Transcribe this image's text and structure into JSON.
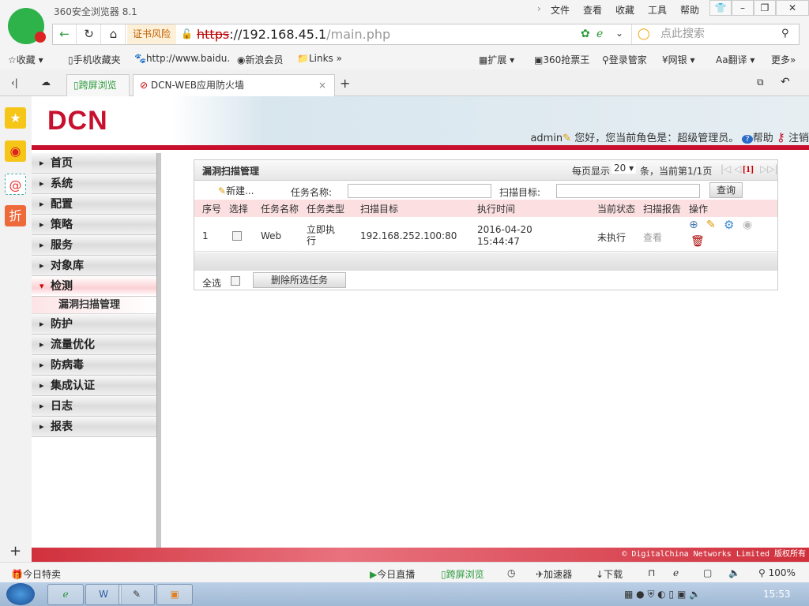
{
  "browser": {
    "title": "360安全浏览器 8.1",
    "menu": [
      "文件",
      "查看",
      "收藏",
      "工具",
      "帮助"
    ],
    "cert": "证书风险",
    "url_scheme": "https",
    "url_host": "://192.168.45.1",
    "url_path": "/main.php",
    "search_placeholder": "点此搜索",
    "bookmarks_left": [
      "收藏",
      "手机收藏夹",
      "http://www.baidu.",
      "新浪会员",
      "Links"
    ],
    "bookmarks_right": [
      "扩展",
      "360抢票王",
      "登录管家",
      "网银",
      "翻译",
      "更多"
    ],
    "tabs": [
      {
        "label": "跨屏浏览"
      },
      {
        "label": "DCN-WEB应用防火墙"
      }
    ]
  },
  "header": {
    "brand": "DCN",
    "user": "admin",
    "greeting": "您好，您当前角色是：超级管理员。",
    "help": "帮助",
    "logout": "注销"
  },
  "nav": {
    "items": [
      "首页",
      "系统",
      "配置",
      "策略",
      "服务",
      "对象库",
      "检测",
      "防护",
      "流量优化",
      "防病毒",
      "集成认证",
      "日志",
      "报表"
    ],
    "active": "检测",
    "subitem": "漏洞扫描管理"
  },
  "panel": {
    "title": "漏洞扫描管理",
    "per_page_label": "每页显示",
    "per_page": "20",
    "page_info": "条，当前第1/1页",
    "page_current": "[1]",
    "new_label": "新建...",
    "task_name_label": "任务名称:",
    "task_name_value": "",
    "scan_target_label": "扫描目标:",
    "scan_target_value": "",
    "query": "查询",
    "columns": [
      "序号",
      "选择",
      "任务名称",
      "任务类型",
      "扫描目标",
      "执行时间",
      "当前状态",
      "扫描报告",
      "操作"
    ],
    "rows": [
      {
        "index": "1",
        "name": "Web",
        "type": "立即执行",
        "target": "192.168.252.100:80",
        "time_date": "2016-04-20",
        "time_clock": "15:44:47",
        "status": "未执行",
        "report": "查看"
      }
    ],
    "select_all": "全选",
    "delete_selected": "删除所选任务"
  },
  "footer": {
    "copyright": "© DigitalChina Networks Limited 版权所有"
  },
  "statusbar": {
    "left": "今日特卖",
    "live": "今日直播",
    "cross": "跨屏浏览",
    "accel": "加速器",
    "download": "下载",
    "zoom": "100%"
  },
  "taskbar": {
    "clock": "15:53"
  },
  "colors": {
    "brand_red": "#c8102e",
    "header_pink": "#fbdfe1"
  }
}
